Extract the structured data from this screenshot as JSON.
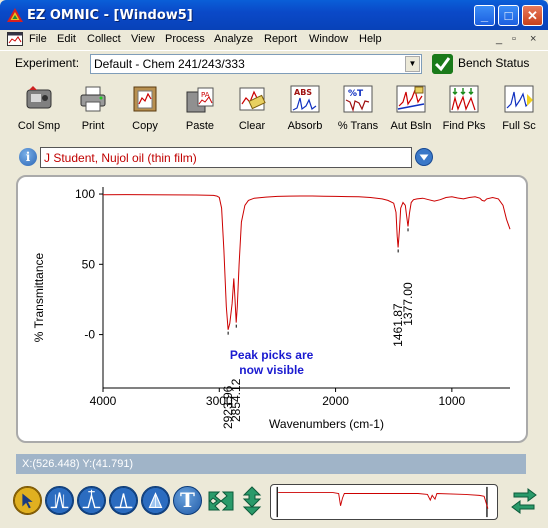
{
  "window": {
    "title": "EZ OMNIC - [Window5]",
    "buttons": {
      "minimize": "_",
      "maximize": "□",
      "close": "✕"
    }
  },
  "menubar": {
    "items": [
      "File",
      "Edit",
      "Collect",
      "View",
      "Process",
      "Analyze",
      "Report",
      "Window",
      "Help"
    ],
    "mdi": {
      "minimize": "_",
      "restore": "▫",
      "close": "×"
    }
  },
  "experiment": {
    "label": "Experiment:",
    "value": "Default - Chem 241/243/333",
    "bench_status": "Bench Status"
  },
  "toolbar": {
    "items": [
      {
        "label": "Col Smp",
        "icon": "collect-sample-icon"
      },
      {
        "label": "Print",
        "icon": "printer-icon"
      },
      {
        "label": "Copy",
        "icon": "copy-icon"
      },
      {
        "label": "Paste",
        "icon": "paste-icon"
      },
      {
        "label": "Clear",
        "icon": "clear-icon"
      },
      {
        "label": "Absorb",
        "icon": "absorbance-icon",
        "badge": "ABS"
      },
      {
        "label": "% Trans",
        "icon": "percent-transmittance-icon",
        "badge": "%T"
      },
      {
        "label": "Aut Bsln",
        "icon": "auto-baseline-icon"
      },
      {
        "label": "Find Pks",
        "icon": "find-peaks-icon"
      },
      {
        "label": "Full Sc",
        "icon": "full-scale-icon"
      }
    ]
  },
  "sample": {
    "name": "J Student, Nujol oil (thin film)"
  },
  "chart_data": {
    "type": "line",
    "xlabel": "Wavenumbers (cm-1)",
    "ylabel": "% Transmittance",
    "xlim": [
      4000,
      500
    ],
    "ylim": [
      -38,
      105
    ],
    "xticks": [
      4000,
      3000,
      2000,
      1000
    ],
    "yticks": [
      100,
      50,
      0
    ],
    "ytick_labels": [
      "100",
      "50",
      "-0"
    ],
    "series": [
      {
        "color": "#cc0000",
        "x": [
          4000,
          3800,
          3600,
          3400,
          3200,
          3100,
          3050,
          3020,
          3000,
          2980,
          2960,
          2940,
          2923.96,
          2910,
          2890,
          2875,
          2865,
          2854.12,
          2845,
          2830,
          2810,
          2780,
          2750,
          2700,
          2600,
          2500,
          2400,
          2300,
          2200,
          2100,
          2000,
          1900,
          1800,
          1700,
          1600,
          1550,
          1500,
          1480,
          1470,
          1461.87,
          1450,
          1440,
          1420,
          1400,
          1390,
          1377,
          1365,
          1350,
          1330,
          1300,
          1250,
          1200,
          1150,
          1100,
          1050,
          1000,
          950,
          900,
          850,
          800,
          760,
          740,
          720,
          700,
          650,
          600,
          560,
          530,
          500
        ],
        "y": [
          99.5,
          99.6,
          99.5,
          99.4,
          99.3,
          99.2,
          99.0,
          98.5,
          97.5,
          90.0,
          60.0,
          20.0,
          3.5,
          8.0,
          22.0,
          40.0,
          25.0,
          8.5,
          20.0,
          50.0,
          80.0,
          92.0,
          95.5,
          97.0,
          97.8,
          98.3,
          98.5,
          98.6,
          98.6,
          98.4,
          98.3,
          98.2,
          98.0,
          97.5,
          96.5,
          95.5,
          93.5,
          87.0,
          70.0,
          62.0,
          75.0,
          90.0,
          94.0,
          92.0,
          85.0,
          77.0,
          86.0,
          94.0,
          96.0,
          96.5,
          97.0,
          96.0,
          95.0,
          96.0,
          97.5,
          98.0,
          97.2,
          96.5,
          97.5,
          98.0,
          97.0,
          95.5,
          95.0,
          96.5,
          97.5,
          96.5,
          92.0,
          82.0,
          75.0
        ]
      }
    ],
    "peak_labels": [
      {
        "x": 2923.96,
        "label": "2923.96"
      },
      {
        "x": 2854.12,
        "label": "2854.12"
      },
      {
        "x": 1461.87,
        "label": "1461.87"
      },
      {
        "x": 1377.0,
        "label": "1377.00"
      }
    ],
    "annotation": [
      "Peak picks are",
      "now visible"
    ],
    "annotation_color": "#1a1ad0"
  },
  "status": {
    "coords": "X:(526.448)  Y:(41.791)"
  },
  "bottom_tools": [
    {
      "icon": "select-arrow-icon"
    },
    {
      "icon": "region-tool-icon"
    },
    {
      "icon": "peak-label-tool-icon"
    },
    {
      "icon": "peak-height-tool-icon"
    },
    {
      "icon": "peak-area-tool-icon"
    },
    {
      "icon": "text-annotation-icon",
      "glyph": "T"
    }
  ]
}
